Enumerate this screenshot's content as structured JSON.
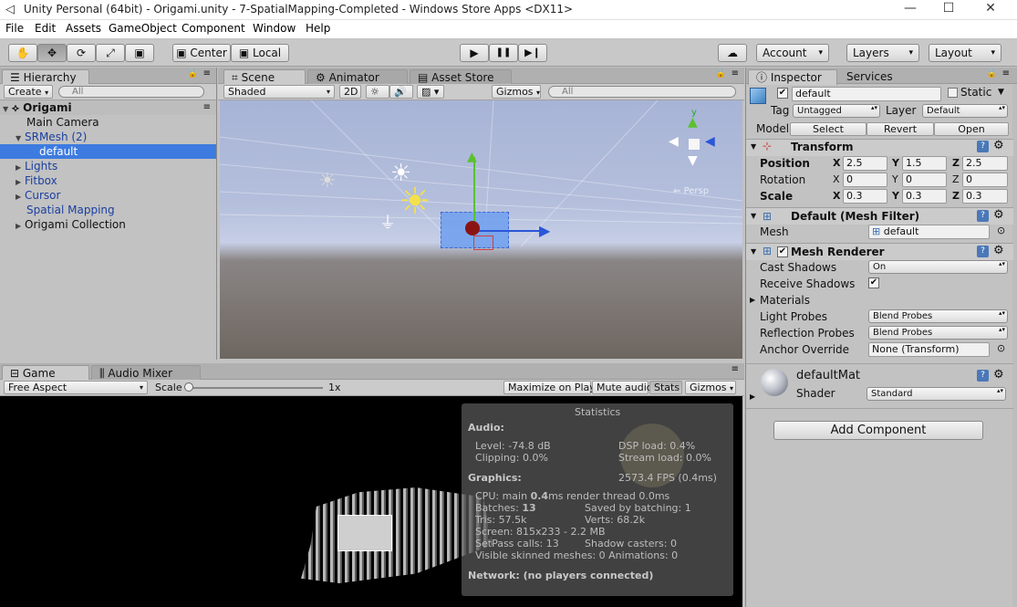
{
  "window": {
    "title": "Unity Personal (64bit) - Origami.unity - 7-SpatialMapping-Completed - Windows Store Apps <DX11>",
    "minimize": "—",
    "maximize": "☐",
    "close": "✕"
  },
  "menu": [
    "File",
    "Edit",
    "Assets",
    "GameObject",
    "Component",
    "Window",
    "Help"
  ],
  "toolbar": {
    "pivot": "Center",
    "space": "Local",
    "account": "Account",
    "layers": "Layers",
    "layout": "Layout",
    "play": "▶",
    "pause": "❚❚",
    "step": "▶❙"
  },
  "hierarchy": {
    "tab": "Hierarchy",
    "create": "Create",
    "search_placeholder": "All",
    "scene": "Origami",
    "items": [
      {
        "label": "Main Camera"
      },
      {
        "label": "SRMesh (2)"
      },
      {
        "label": "default"
      },
      {
        "label": "Lights"
      },
      {
        "label": "Fitbox"
      },
      {
        "label": "Cursor"
      },
      {
        "label": "Spatial Mapping"
      },
      {
        "label": "Origami Collection"
      }
    ]
  },
  "scene": {
    "tabs": [
      "Scene",
      "Animator",
      "Asset Store"
    ],
    "shading": "Shaded",
    "mode2d": "2D",
    "gizmos": "Gizmos",
    "search_placeholder": "All",
    "persp": "Persp",
    "gizmo_y": "y"
  },
  "game": {
    "tabs": [
      "Game",
      "Audio Mixer"
    ],
    "aspect": "Free Aspect",
    "scale_label": "Scale",
    "scale_value": "1x",
    "maximize": "Maximize on Play",
    "mute": "Mute audio",
    "stats": "Stats",
    "gizmos": "Gizmos"
  },
  "stats": {
    "title": "Statistics",
    "audio": "Audio:",
    "level": "Level: -74.8 dB",
    "dsp": "DSP load: 0.4%",
    "clipping": "Clipping: 0.0%",
    "stream": "Stream load: 0.0%",
    "graphics": "Graphics:",
    "fps": "2573.4 FPS (0.4ms)",
    "cpu_a": "CPU: main ",
    "cpu_b": "0.4",
    "cpu_c": "ms  render thread 0.0ms",
    "batches_a": "Batches: ",
    "batches_b": "13",
    "saved": "Saved by batching: 1",
    "tris": "Tris: 57.5k",
    "verts": "Verts: 68.2k",
    "screen": "Screen: 815x233 - 2.2 MB",
    "setpass": "SetPass calls: 13",
    "shadow": "Shadow casters: 0",
    "skinned": "Visible skinned meshes: 0  Animations: 0",
    "network": "Network: (no players connected)"
  },
  "inspector": {
    "tabs": [
      "Inspector",
      "Services"
    ],
    "name": "default",
    "static": "Static",
    "tag_label": "Tag",
    "tag": "Untagged",
    "layer_label": "Layer",
    "layer": "Default",
    "model_label": "Model",
    "select": "Select",
    "revert": "Revert",
    "open": "Open",
    "transform": {
      "title": "Transform",
      "position": "Position",
      "rotation": "Rotation",
      "scale": "Scale",
      "pos": [
        "2.5",
        "1.5",
        "2.5"
      ],
      "rot": [
        "0",
        "0",
        "0"
      ],
      "scl": [
        "0.3",
        "0.3",
        "0.3"
      ],
      "axes": [
        "X",
        "Y",
        "Z"
      ]
    },
    "meshfilter": {
      "title": "Default (Mesh Filter)",
      "mesh_label": "Mesh",
      "mesh": "default"
    },
    "meshrenderer": {
      "title": "Mesh Renderer",
      "cast_label": "Cast Shadows",
      "cast": "On",
      "receive_label": "Receive Shadows",
      "materials": "Materials",
      "light_label": "Light Probes",
      "light": "Blend Probes",
      "refl_label": "Reflection Probes",
      "refl": "Blend Probes",
      "anchor_label": "Anchor Override",
      "anchor": "None (Transform)"
    },
    "material": {
      "name": "defaultMat",
      "shader_label": "Shader",
      "shader": "Standard"
    },
    "add_component": "Add Component"
  },
  "colors": {
    "selection": "#3d7be0",
    "sky": "#9aa6c8",
    "ground": "#6e6660",
    "game_bg": "#000000"
  }
}
